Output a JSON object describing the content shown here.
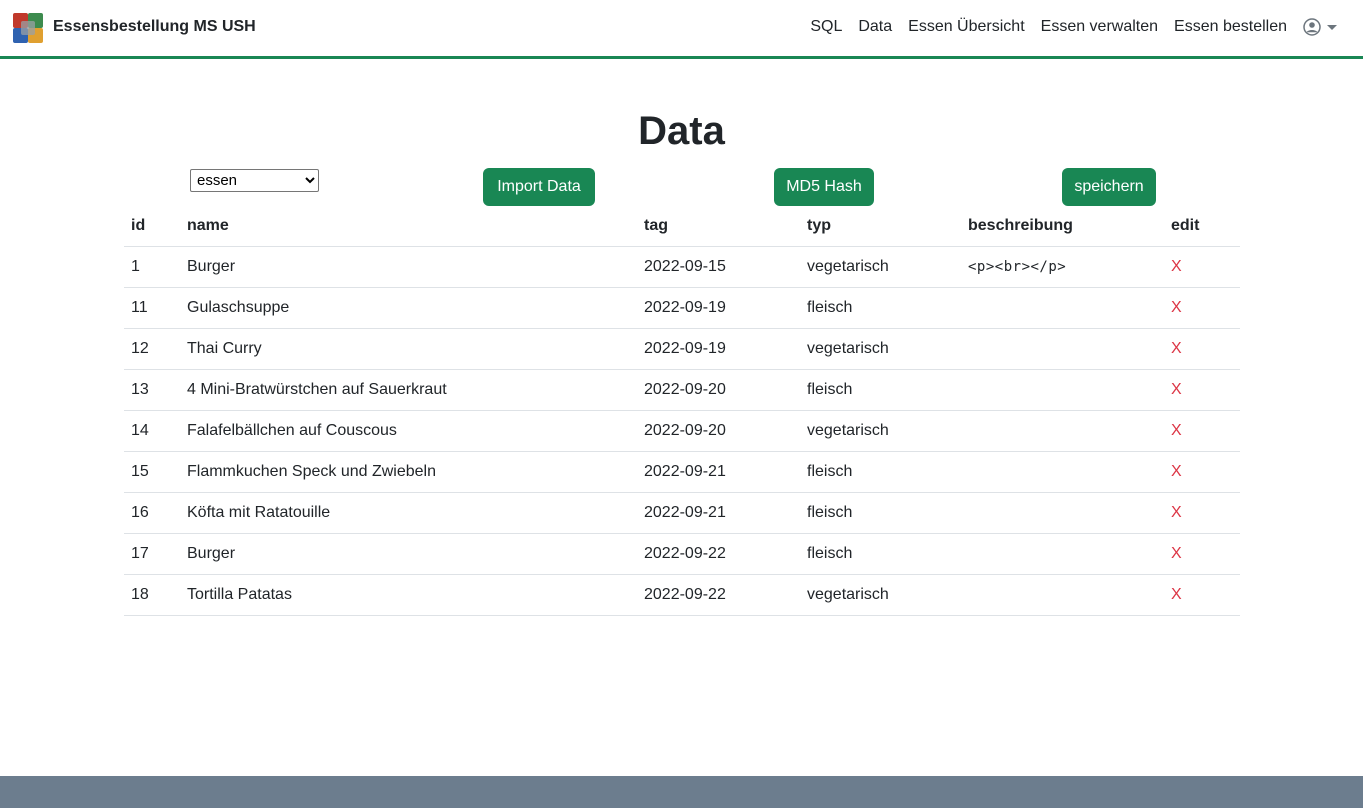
{
  "brand": {
    "title": "Essensbestellung MS USH",
    "logo_colors": [
      "#c0392b",
      "#3d8b4e",
      "#2f62b0",
      "#e0a030"
    ]
  },
  "nav": {
    "links": [
      "SQL",
      "Data",
      "Essen Übersicht",
      "Essen verwalten",
      "Essen bestellen"
    ]
  },
  "main": {
    "title": "Data",
    "table_select": {
      "value": "essen",
      "options": [
        "essen"
      ]
    },
    "buttons": {
      "import": "Import Data",
      "md5": "MD5 Hash",
      "save": "speichern"
    }
  },
  "table": {
    "headers": [
      "id",
      "name",
      "tag",
      "typ",
      "beschreibung",
      "edit"
    ],
    "rows": [
      [
        "1",
        "Burger",
        "2022-09-15",
        "vegetarisch",
        "<p><br></p>",
        "X"
      ],
      [
        "11",
        "Gulaschsuppe",
        "2022-09-19",
        "fleisch",
        "",
        "X"
      ],
      [
        "12",
        "Thai Curry",
        "2022-09-19",
        "vegetarisch",
        "",
        "X"
      ],
      [
        "13",
        "4 Mini-Bratwürstchen auf Sauerkraut",
        "2022-09-20",
        "fleisch",
        "",
        "X"
      ],
      [
        "14",
        "Falafelbällchen auf Couscous",
        "2022-09-20",
        "vegetarisch",
        "",
        "X"
      ],
      [
        "15",
        "Flammkuchen Speck und Zwiebeln",
        "2022-09-21",
        "fleisch",
        "",
        "X"
      ],
      [
        "16",
        "Köfta mit Ratatouille",
        "2022-09-21",
        "fleisch",
        "",
        "X"
      ],
      [
        "17",
        "Burger",
        "2022-09-22",
        "fleisch",
        "",
        "X"
      ],
      [
        "18",
        "Tortilla Patatas",
        "2022-09-22",
        "vegetarisch",
        "",
        "X"
      ]
    ]
  },
  "colors": {
    "accent": "#198754",
    "delete": "#dc3545",
    "footer": "#6c7d8e"
  }
}
